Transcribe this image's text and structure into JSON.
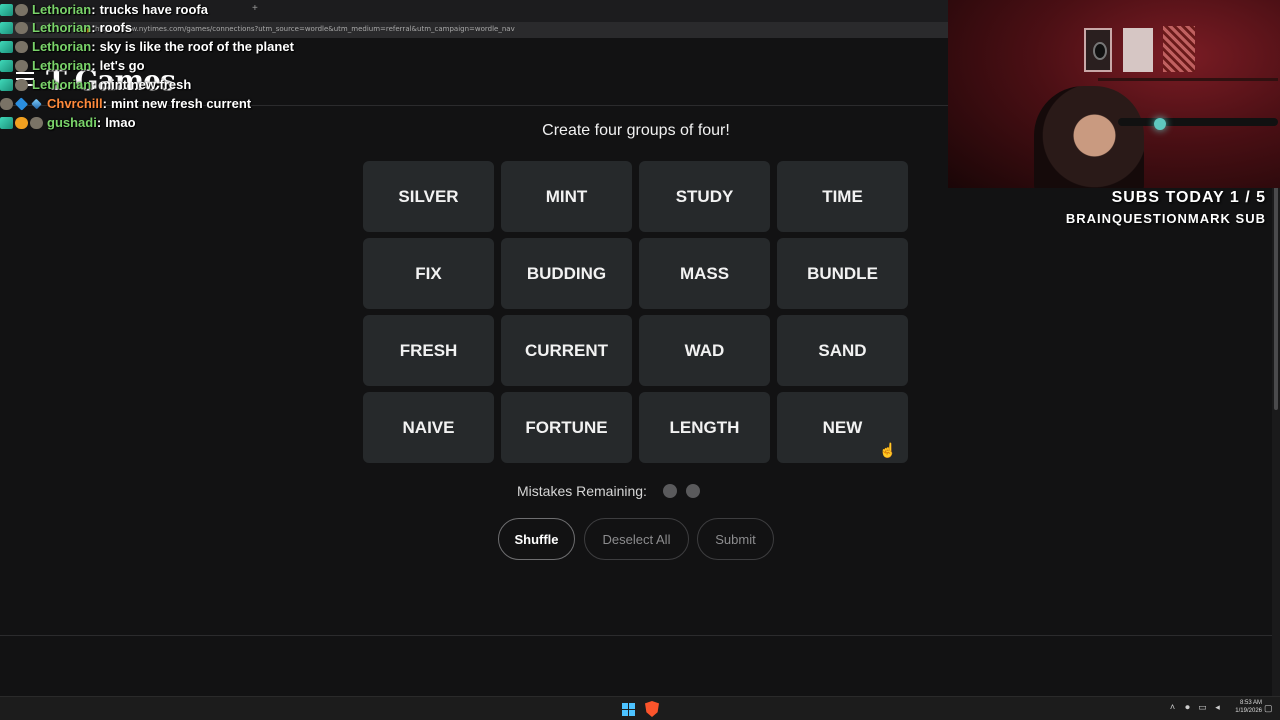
{
  "browser": {
    "url": "https://www.nytimes.com/games/connections?utm_source=wordle&utm_medium=referral&utm_campaign=wordle_nav",
    "new_tab_glyph": "+"
  },
  "header": {
    "brand_t": "T",
    "brand_name": "Games",
    "menu_icon": "hamburger-menu-icon"
  },
  "chat": [
    {
      "name": "Lethorian",
      "sep": ":",
      "message": "trucks have roofa",
      "badges": [
        "teal",
        "gray"
      ]
    },
    {
      "name": "Lethorian",
      "sep": ":",
      "message": "roofs",
      "badges": [
        "teal",
        "gray"
      ]
    },
    {
      "name": "Lethorian",
      "sep": ":",
      "message": "sky is like the roof of the planet",
      "badges": [
        "teal",
        "gray"
      ]
    },
    {
      "name": "Lethorian",
      "sep": ":",
      "message": "let's go",
      "badges": [
        "teal",
        "gray"
      ]
    },
    {
      "name": "Lethorian",
      "sep": ":",
      "message": "mint new fresh",
      "badges": [
        "teal",
        "gray"
      ]
    },
    {
      "name": "Chvrchill",
      "sep": ":",
      "message": "mint new fresh current",
      "badges": [
        "gray",
        "blue",
        "sword"
      ]
    },
    {
      "name": "gushadi",
      "sep": ":",
      "message": "lmao",
      "badges": [
        "teal",
        "orange",
        "gray"
      ]
    }
  ],
  "game": {
    "prompt": "Create four groups of four!",
    "tiles": [
      "SILVER",
      "MINT",
      "STUDY",
      "TIME",
      "FIX",
      "BUDDING",
      "MASS",
      "BUNDLE",
      "FRESH",
      "CURRENT",
      "WAD",
      "SAND",
      "NAIVE",
      "FORTUNE",
      "LENGTH",
      "NEW"
    ],
    "mistakes_label": "Mistakes Remaining:",
    "mistakes_remaining": 2,
    "buttons": {
      "shuffle": "Shuffle",
      "deselect": "Deselect All",
      "submit": "Submit"
    }
  },
  "stream_overlay": {
    "subs_today": "SUBS TODAY 1 / 5",
    "sub_goal_text": "BRAINQUESTIONMARK SUB"
  },
  "taskbar": {
    "time": "8:53 AM",
    "date": "1/19/2026",
    "icons": [
      "windows-start-icon",
      "brave-browser-icon"
    ]
  },
  "colors": {
    "background": "#121213",
    "tile": "#26292b",
    "chat_name_green": "#7ad36a",
    "chat_name_orange": "#ff8a3c"
  }
}
